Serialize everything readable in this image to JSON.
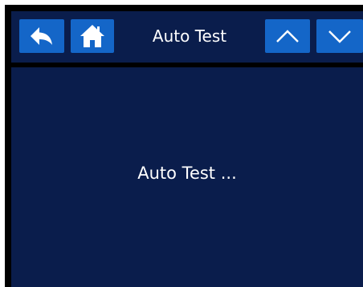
{
  "header": {
    "title": "Auto Test",
    "buttons": {
      "back": {
        "icon": "back-arrow-icon"
      },
      "home": {
        "icon": "home-icon"
      },
      "up": {
        "icon": "chevron-up-icon"
      },
      "down": {
        "icon": "chevron-down-icon"
      }
    }
  },
  "main": {
    "message": "Auto Test ..."
  },
  "colors": {
    "panel_background": "#0a1d4c",
    "button_background": "#1466c8",
    "frame": "#000000",
    "text": "#ffffff"
  }
}
